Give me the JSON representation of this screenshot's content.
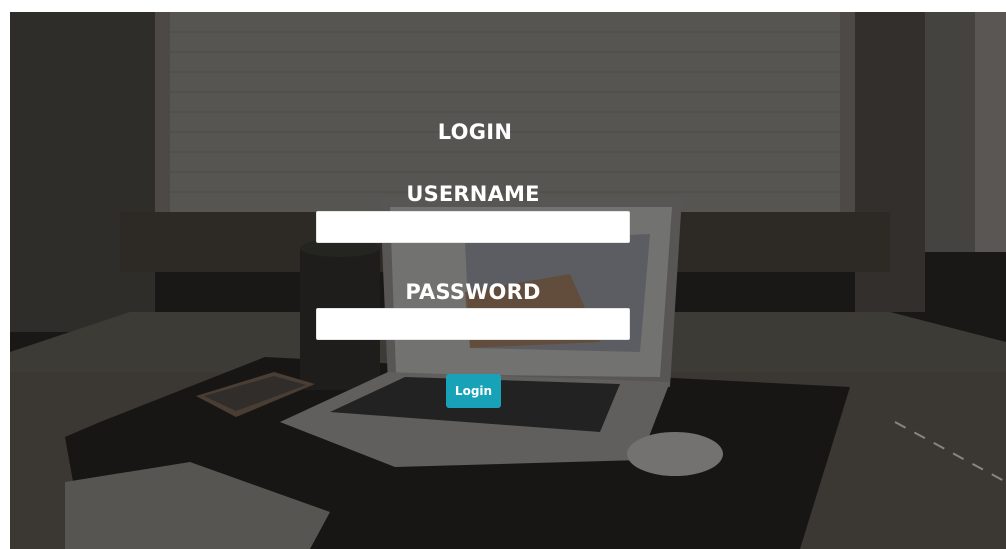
{
  "login": {
    "title": "LOGIN",
    "username_label": "USERNAME",
    "username_value": "",
    "username_placeholder": "",
    "password_label": "PASSWORD",
    "password_value": "",
    "password_placeholder": "",
    "submit_label": "Login"
  },
  "colors": {
    "accent": "#17a2b8",
    "label_text": "#ffffff",
    "input_background": "#ffffff"
  }
}
